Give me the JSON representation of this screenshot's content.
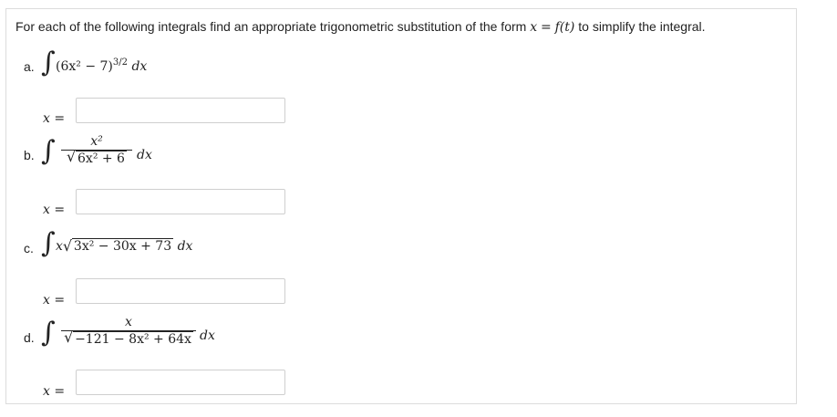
{
  "instruction": {
    "prefix": "For each of the following integrals find an appropriate trigonometric substitution of the form",
    "form_x": "x",
    "form_eq": "=",
    "form_f": "f(t)",
    "suffix": "to simplify the integral."
  },
  "problems": [
    {
      "label": "a.",
      "integrand": "(6x² − 7)",
      "power": "3/2",
      "dx": "dx",
      "var": "x",
      "eq": "=",
      "answer": ""
    },
    {
      "label": "b.",
      "numerator": "x²",
      "radicand": "6x² + 6",
      "dx": "dx",
      "var": "x",
      "eq": "=",
      "answer": ""
    },
    {
      "label": "c.",
      "prefix": "x",
      "radicand": "3x² − 30x + 73",
      "dx": "dx",
      "var": "x",
      "eq": "=",
      "answer": ""
    },
    {
      "label": "d.",
      "numerator": "x",
      "radicand": "−121 − 8x² + 64x",
      "dx": "dx",
      "var": "x",
      "eq": "=",
      "answer": ""
    }
  ]
}
